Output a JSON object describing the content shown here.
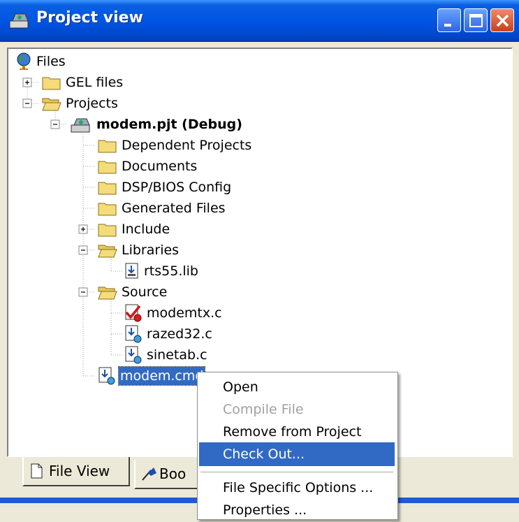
{
  "window": {
    "title": "Project view"
  },
  "tree": {
    "root": "Files",
    "gel_files": "GEL files",
    "projects": "Projects",
    "project": "modem.pjt (Debug)",
    "dependent_projects": "Dependent Projects",
    "documents": "Documents",
    "dsp_bios_config": "DSP/BIOS Config",
    "generated_files": "Generated Files",
    "include": "Include",
    "libraries": "Libraries",
    "lib_file": "rts55.lib",
    "source": "Source",
    "src1": "modemtx.c",
    "src2": "razed32.c",
    "src3": "sinetab.c",
    "cmd_file": "modem.cmd"
  },
  "tabs": {
    "file_view": "File View",
    "bookmarks": "Boo"
  },
  "context_menu": {
    "open": "Open",
    "compile": "Compile File",
    "remove": "Remove from Project",
    "check_out": "Check Out...",
    "file_options": "File Specific Options ...",
    "properties": "Properties ..."
  },
  "colors": {
    "title_blue": "#0055e5",
    "selection": "#316ac5",
    "folder": "#f5dc7a"
  }
}
